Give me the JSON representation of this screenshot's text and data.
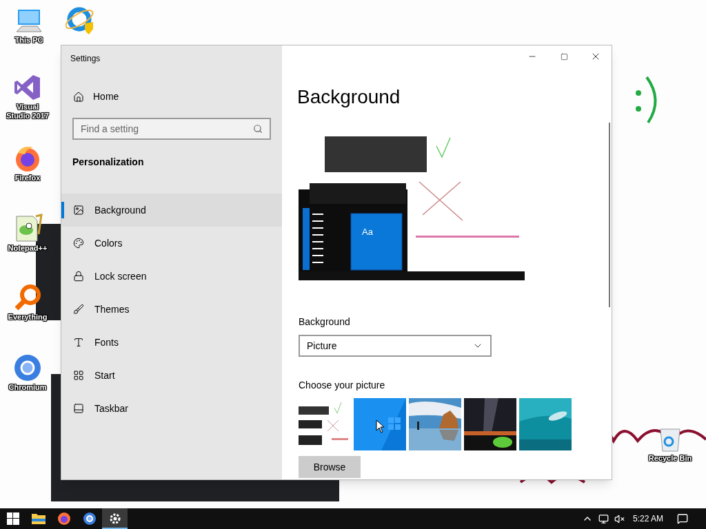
{
  "desktop_icons": [
    {
      "kind": "pc",
      "label": "This PC"
    },
    {
      "kind": "ie"
    },
    {
      "kind": "vs",
      "label": "Visual Studio 2017"
    },
    {
      "kind": "firefox",
      "label": "Firefox"
    },
    {
      "kind": "notepad",
      "label": "Notepad++"
    },
    {
      "kind": "everything",
      "label": "Everything"
    },
    {
      "kind": "chromium",
      "label": "Chromium"
    },
    {
      "kind": "recycle",
      "label": "Recycle Bin"
    }
  ],
  "window": {
    "title": "Settings"
  },
  "sidebar": {
    "home": "Home",
    "search": {
      "placeholder": "Find a setting"
    },
    "section": "Personalization",
    "items": [
      {
        "kind": "background",
        "label": "Background",
        "selected": true
      },
      {
        "kind": "colors",
        "label": "Colors",
        "selected": false
      },
      {
        "kind": "lock",
        "label": "Lock screen",
        "selected": false
      },
      {
        "kind": "themes",
        "label": "Themes",
        "selected": false
      },
      {
        "kind": "fonts",
        "label": "Fonts",
        "selected": false
      },
      {
        "kind": "start",
        "label": "Start",
        "selected": false
      },
      {
        "kind": "taskbar",
        "label": "Taskbar",
        "selected": false
      }
    ]
  },
  "content": {
    "title": "Background",
    "preview": {
      "tile_label": "Aa"
    },
    "background_label": "Background",
    "background_value": "Picture",
    "choose_label": "Choose your picture",
    "pictures": [
      {
        "kind": "handwriting"
      },
      {
        "kind": "blue"
      },
      {
        "kind": "beach"
      },
      {
        "kind": "night"
      },
      {
        "kind": "underwater"
      }
    ],
    "browse": "Browse"
  },
  "taskbar": {
    "apps": [
      {
        "kind": "start",
        "active": false
      },
      {
        "kind": "folder",
        "active": false
      },
      {
        "kind": "firefox",
        "active": false
      },
      {
        "kind": "chrome",
        "active": false
      },
      {
        "kind": "gear",
        "active": true
      }
    ],
    "time": "5:22 AM"
  }
}
